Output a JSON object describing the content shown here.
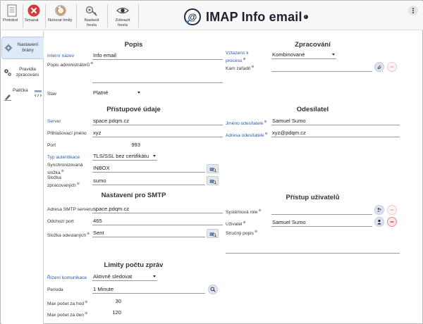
{
  "toolbar": {
    "protokol": "Protokol",
    "smazat": "Smazat",
    "nulovat": "Nulovat limity",
    "nastavit_hesla": "Nastavit hesla",
    "zobrazit_hesla": "Zobrazit hesla"
  },
  "header": {
    "title": "IMAP Info email",
    "badge": "i"
  },
  "sidebar": {
    "items": [
      {
        "label": "Nastavení brány",
        "active": true
      },
      {
        "label": "Pravidla zpracování",
        "active": false
      },
      {
        "label": "Patička",
        "active": false
      }
    ]
  },
  "popis": {
    "title": "Popis",
    "interni_nazev_label": "Interní název",
    "interni_nazev_value": "Info email",
    "popis_admin_label": "Popis administrátorů",
    "stav_label": "Stav",
    "stav_value": "Platné"
  },
  "zpracovani": {
    "title": "Zpracování",
    "vztazeno_label": "Vztazeno k procesu",
    "vztazeno_value": "Kombinované",
    "kam_zaradit_label": "Kam zařadit"
  },
  "pristupove": {
    "title": "Přístupové údaje",
    "server_label": "Server",
    "server_value": "space.pdqm.cz",
    "prihlasovaci_label": "Přihlašovací jméno",
    "prihlasovaci_value": "xyz",
    "port_label": "Port",
    "port_value": "993",
    "typ_label": "Typ autentikace",
    "typ_value": "TLS/SSL bez certifikátu",
    "sync_label": "Synchronizovaná složka",
    "sync_value": "INBOX",
    "zprac_label": "Složka zpracovaných",
    "zprac_value": "sumo"
  },
  "odesilatel": {
    "title": "Odesílatel",
    "jmeno_label": "Jméno odesílatele",
    "jmeno_value": "Samuel Sumo",
    "adresa_label": "Adresa odesílatele",
    "adresa_value": "xyz@pdqm.cz"
  },
  "smtp": {
    "title": "Nastavení pro SMTP",
    "adresa_label": "Adresa SMTP serveru",
    "adresa_value": "space.pdqm.cz",
    "port_label": "Odchozí port",
    "port_value": "465",
    "slozka_label": "Složka odeslaných",
    "slozka_value": "Sent"
  },
  "pristup": {
    "title": "Přístup uživatelů",
    "role_label": "Systémová role",
    "uzivatel_label": "Uživatel",
    "uzivatel_value": "Samuel Sumo",
    "strucny_label": "Stručný popis"
  },
  "limity": {
    "title": "Limity počtu zpráv",
    "rizeni_label": "Řízení komunikace",
    "rizeni_value": "Aktivně sledovat",
    "perioda_label": "Perioda",
    "perioda_value": "1 Minute",
    "hod_label": "Max počet za hod",
    "hod_value": "30",
    "den_label": "Max počet za den",
    "den_value": "120"
  },
  "icons": [
    "document-icon",
    "delete-icon",
    "reset-icon",
    "key-icon",
    "eye-icon",
    "gear-icon",
    "rules-icon",
    "footer-icon",
    "search-icon",
    "attach-icon",
    "remove-icon",
    "user-icon",
    "role-icon",
    "menu-icon",
    "logo-icon"
  ],
  "colors": {
    "blue_label": "#2d5aa8",
    "delete_red": "#d23b3b",
    "tab_active": "#dfe9f7"
  }
}
